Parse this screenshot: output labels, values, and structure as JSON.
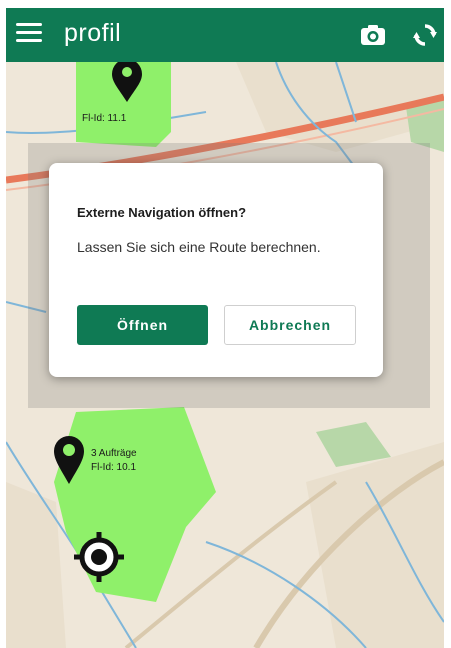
{
  "app": {
    "title": "profil"
  },
  "toolbar": {
    "menu_icon": "hamburger-menu-icon",
    "camera_icon": "camera-icon",
    "sync_icon": "sync-icon"
  },
  "map": {
    "fields": [
      {
        "id_label": "Fl-Id: 11.1"
      },
      {
        "orders_label": "3 Aufträge",
        "id_label": "Fl-Id: 10.1"
      }
    ],
    "locate_icon": "gps-locate-icon",
    "marker_icon": "map-pin-icon"
  },
  "dialog": {
    "title": "Externe Navigation öffnen?",
    "message": "Lassen Sie sich eine Route berechnen.",
    "confirm_label": "Öffnen",
    "cancel_label": "Abbrechen"
  },
  "colors": {
    "primary": "#0f7a54",
    "field_fill": "#8ff06a",
    "map_background": "#efe7d9",
    "road": "#e8795a",
    "water": "#7fb6d9"
  }
}
